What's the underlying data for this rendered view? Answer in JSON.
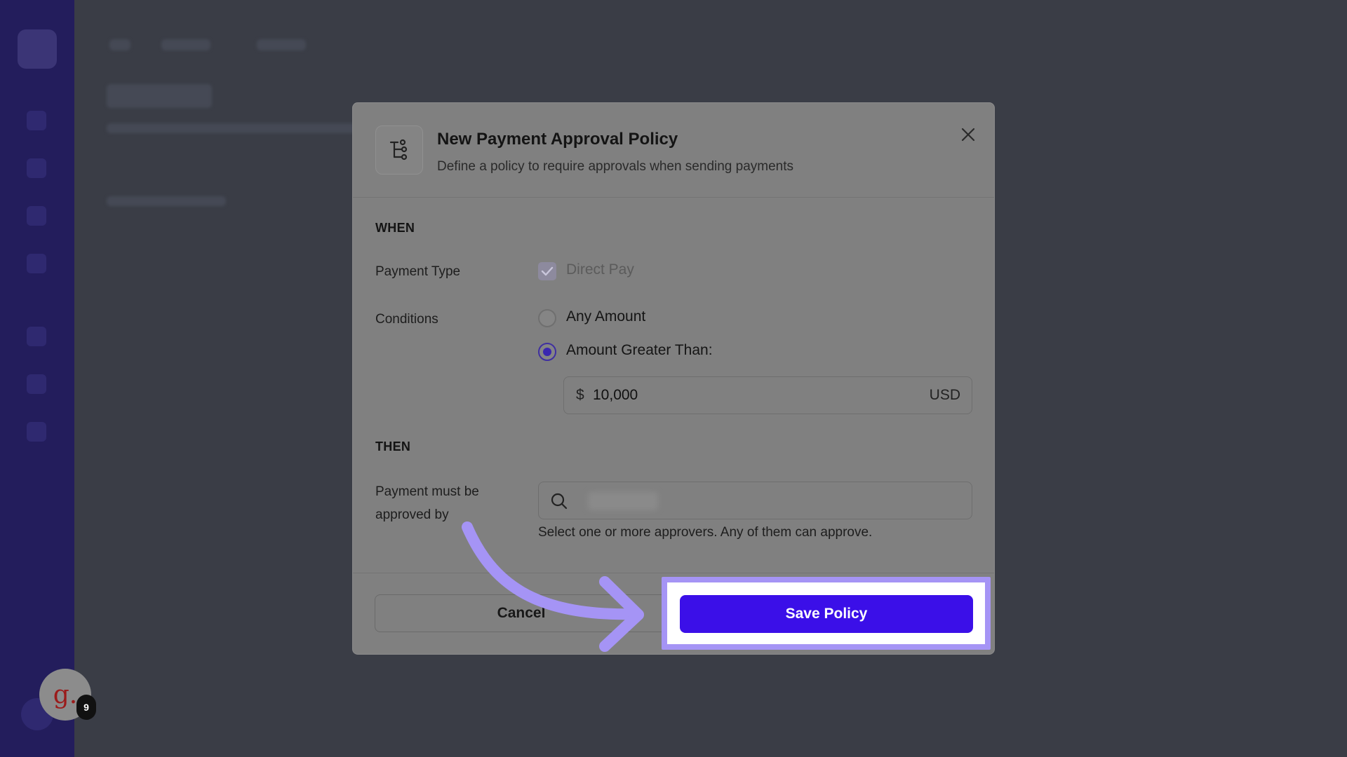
{
  "modal": {
    "title": "New Payment Approval Policy",
    "subtitle": "Define a policy to require approvals when sending payments",
    "icon": "tree-structure-icon",
    "close_icon": "close-icon"
  },
  "when": {
    "section_label": "WHEN",
    "payment_type_label": "Payment Type",
    "payment_type_option": "Direct Pay",
    "payment_type_checked": true,
    "conditions_label": "Conditions",
    "condition_options": [
      "Any Amount",
      "Amount Greater Than:"
    ],
    "selected_condition": "Amount Greater Than:",
    "amount": {
      "symbol": "$",
      "value": "10,000",
      "currency": "USD"
    }
  },
  "then": {
    "section_label": "THEN",
    "approvers_label_line1": "Payment must be",
    "approvers_label_line2": "approved by",
    "search_icon": "search-icon",
    "helper_text": "Select one or more approvers. Any of them can approve."
  },
  "footer": {
    "cancel_label": "Cancel",
    "save_label": "Save Policy"
  },
  "overlay": {
    "avatar_letter": "g.",
    "badge_count": "9",
    "highlight_color": "#a594f5",
    "arrow_color": "#a594f5",
    "primary_color": "#3b0fe8"
  }
}
